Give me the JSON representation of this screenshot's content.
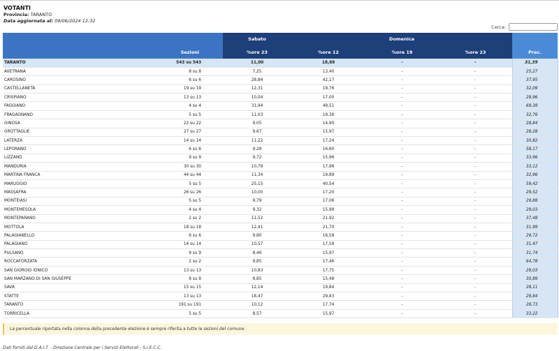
{
  "header": {
    "title": "VOTANTI",
    "provincia_label": "Provincia:",
    "provincia_value": "TARANTO",
    "updated_label": "Data aggiornata al:",
    "updated_value": "09/06/2024 12:32"
  },
  "search": {
    "label": "Cerca:",
    "value": ""
  },
  "table": {
    "group_headers": {
      "saturday": "Sabato",
      "sunday": "Domenica"
    },
    "columns": [
      "Sezioni",
      "%ore 23",
      "%ore 12",
      "%ore 19",
      "%ore 23",
      "Prec."
    ],
    "total": {
      "comune": "TARANTO",
      "sezioni": "543 su 543",
      "sat23": "11,00",
      "sun12": "18,69",
      "sun19": "-",
      "sun23": "-",
      "prec": "31,39"
    },
    "rows": [
      {
        "comune": "AVETRANA",
        "sezioni": "8 su 8",
        "sat23": "7,25",
        "sun12": "13,40",
        "sun19": "-",
        "sun23": "-",
        "prec": "25,27"
      },
      {
        "comune": "CAROSINO",
        "sezioni": "6 su 6",
        "sat23": "28,84",
        "sun12": "42,17",
        "sun19": "-",
        "sun23": "-",
        "prec": "37,95"
      },
      {
        "comune": "CASTELLANETA",
        "sezioni": "19 su 19",
        "sat23": "12,31",
        "sun12": "19,76",
        "sun19": "-",
        "sun23": "-",
        "prec": "32,09"
      },
      {
        "comune": "CRISPIANO",
        "sezioni": "13 su 13",
        "sat23": "10,04",
        "sun12": "17,00",
        "sun19": "-",
        "sun23": "-",
        "prec": "29,96"
      },
      {
        "comune": "FAGGIANO",
        "sezioni": "4 su 4",
        "sat23": "31,94",
        "sun12": "49,51",
        "sun19": "-",
        "sun23": "-",
        "prec": "69,38"
      },
      {
        "comune": "FRAGAGNANO",
        "sezioni": "5 su 5",
        "sat23": "11,03",
        "sun12": "19,36",
        "sun19": "-",
        "sun23": "-",
        "prec": "32,76"
      },
      {
        "comune": "GINOSA",
        "sezioni": "22 su 22",
        "sat23": "9,05",
        "sun12": "14,90",
        "sun19": "-",
        "sun23": "-",
        "prec": "28,84"
      },
      {
        "comune": "GROTTAGLIE",
        "sezioni": "27 su 27",
        "sat23": "9,67",
        "sun12": "15,97",
        "sun19": "-",
        "sun23": "-",
        "prec": "28,28"
      },
      {
        "comune": "LATERZA",
        "sezioni": "14 su 14",
        "sat23": "11,22",
        "sun12": "17,24",
        "sun19": "-",
        "sun23": "-",
        "prec": "30,82"
      },
      {
        "comune": "LEPORANO",
        "sezioni": "6 su 6",
        "sat23": "9,28",
        "sun12": "16,60",
        "sun19": "-",
        "sun23": "-",
        "prec": "58,17"
      },
      {
        "comune": "LIZZANO",
        "sezioni": "9 su 9",
        "sat23": "9,72",
        "sun12": "15,96",
        "sun19": "-",
        "sun23": "-",
        "prec": "33,96"
      },
      {
        "comune": "MANDURIA",
        "sezioni": "30 su 30",
        "sat23": "10,79",
        "sun12": "17,96",
        "sun19": "-",
        "sun23": "-",
        "prec": "33,12"
      },
      {
        "comune": "MARTINA FRANCA",
        "sezioni": "44 su 44",
        "sat23": "11,34",
        "sun12": "19,89",
        "sun19": "-",
        "sun23": "-",
        "prec": "32,96"
      },
      {
        "comune": "MARUGGIO",
        "sezioni": "5 su 5",
        "sat23": "25,15",
        "sun12": "40,54",
        "sun19": "-",
        "sun23": "-",
        "prec": "59,42"
      },
      {
        "comune": "MASSAFRA",
        "sezioni": "26 su 26",
        "sat23": "10,00",
        "sun12": "17,20",
        "sun19": "-",
        "sun23": "-",
        "prec": "29,52"
      },
      {
        "comune": "MONTEIASI",
        "sezioni": "5 su 5",
        "sat23": "9,79",
        "sun12": "17,06",
        "sun19": "-",
        "sun23": "-",
        "prec": "29,88"
      },
      {
        "comune": "MONTEMESOLA",
        "sezioni": "4 su 4",
        "sat23": "9,32",
        "sun12": "15,99",
        "sun19": "-",
        "sun23": "-",
        "prec": "29,03"
      },
      {
        "comune": "MONTEPARANO",
        "sezioni": "2 su 2",
        "sat23": "11,52",
        "sun12": "21,92",
        "sun19": "-",
        "sun23": "-",
        "prec": "37,48"
      },
      {
        "comune": "MOTTOLA",
        "sezioni": "18 su 18",
        "sat23": "12,41",
        "sun12": "21,70",
        "sun19": "-",
        "sun23": "-",
        "prec": "31,99"
      },
      {
        "comune": "PALAGIANELLO",
        "sezioni": "6 su 6",
        "sat23": "9,80",
        "sun12": "16,58",
        "sun19": "-",
        "sun23": "-",
        "prec": "29,72"
      },
      {
        "comune": "PALAGIANO",
        "sezioni": "14 su 14",
        "sat23": "10,57",
        "sun12": "17,59",
        "sun19": "-",
        "sun23": "-",
        "prec": "31,47"
      },
      {
        "comune": "PULSANO",
        "sezioni": "9 su 9",
        "sat23": "8,46",
        "sun12": "15,97",
        "sun19": "-",
        "sun23": "-",
        "prec": "31,74"
      },
      {
        "comune": "ROCCAFORZATA",
        "sezioni": "2 su 2",
        "sat23": "9,85",
        "sun12": "17,46",
        "sun19": "-",
        "sun23": "-",
        "prec": "64,78"
      },
      {
        "comune": "SAN GIORGIO IONICO",
        "sezioni": "13 su 13",
        "sat23": "10,83",
        "sun12": "17,75",
        "sun19": "-",
        "sun23": "-",
        "prec": "29,03"
      },
      {
        "comune": "SAN MARZANO DI SAN GIUSEPPE",
        "sezioni": "8 su 8",
        "sat23": "8,85",
        "sun12": "15,48",
        "sun19": "-",
        "sun23": "-",
        "prec": "30,89"
      },
      {
        "comune": "SAVA",
        "sezioni": "15 su 15",
        "sat23": "12,14",
        "sun12": "19,84",
        "sun19": "-",
        "sun23": "-",
        "prec": "28,11"
      },
      {
        "comune": "STATTE",
        "sezioni": "13 su 13",
        "sat23": "18,47",
        "sun12": "29,83",
        "sun19": "-",
        "sun23": "-",
        "prec": "29,84"
      },
      {
        "comune": "TARANTO",
        "sezioni": "191 su 191",
        "sat23": "10,12",
        "sun12": "17,74",
        "sun19": "-",
        "sun23": "-",
        "prec": "28,73"
      },
      {
        "comune": "TORRICELLA",
        "sezioni": "5 su 5",
        "sat23": "8,57",
        "sun12": "15,97",
        "sun19": "-",
        "sun23": "-",
        "prec": "33,22"
      }
    ]
  },
  "note": "La percentuale riportata nella colonna della precedente elezione è sempre riferita a tutte le sezioni del comune.",
  "footer": "Dati forniti dal D.A.I.T. - Direzione Centrale per i Servizi Elettorali - S.I.E.C.C."
}
